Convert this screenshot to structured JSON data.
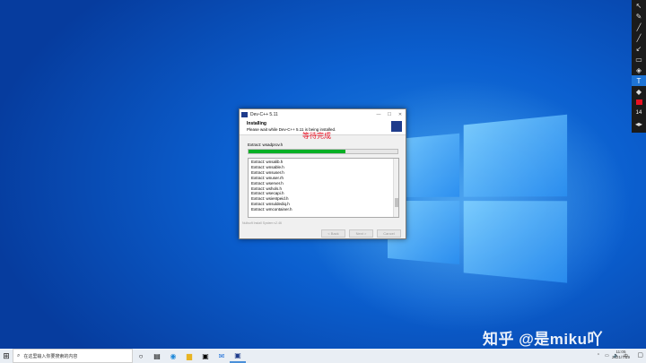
{
  "installer": {
    "window_title": "Dev-C++ 5.11",
    "header_title": "Installing",
    "header_subtitle": "Please wait while Dev-C++ 5.11 is being installed.",
    "current_extract": "Extract: wsadprov.h",
    "progress_percent": 65,
    "log_lines": [
      "Extract: wnsalib.h",
      "Extract: wnsable.h",
      "Extract: wnsuser.h",
      "Extract: wnuser.rh",
      "Extract: wserver.h",
      "Extract: wshols.h",
      "Extract: wsecapi.h",
      "Extract: wsientpeid.h",
      "Extract: wnsuldediq.h",
      "Extract: wmcontainer.h"
    ],
    "branding": "Nullsoft Install System v2.46",
    "buttons": {
      "back": "< Back",
      "next": "Next >",
      "cancel": "Cancel"
    }
  },
  "annotation_text": "等待完成",
  "watermark": "知乎 @是miku吖",
  "taskbar": {
    "search_placeholder": "在这里输入你要搜索的内容",
    "clock_time": "11:05",
    "clock_date": "2021/7/19",
    "tray_lang": "中"
  },
  "annotation_toolbar": {
    "font_size": "14"
  },
  "colors": {
    "progress": "#06b025",
    "annotation": "#e81123",
    "accent": "#0b5fcf"
  }
}
